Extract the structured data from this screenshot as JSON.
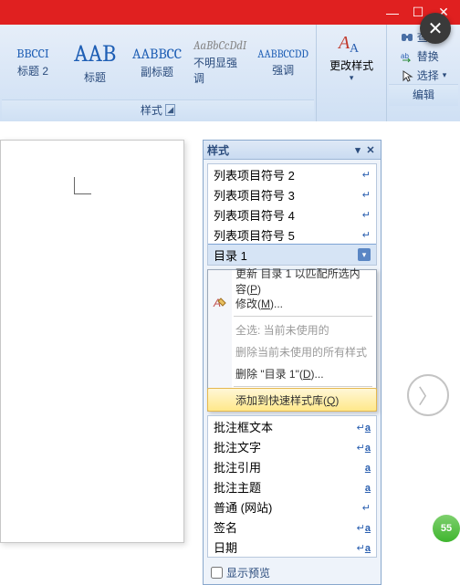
{
  "window": {
    "min": "—",
    "max": "☐",
    "close": "✕"
  },
  "ribbon": {
    "styles": [
      {
        "sample": "BBCCI",
        "label": "标题 2",
        "size": "14px",
        "color": "#1f5fb5"
      },
      {
        "sample": "AAB",
        "label": "标题",
        "size": "26px",
        "color": "#1f5fb5"
      },
      {
        "sample": "AABBCC",
        "label": "副标题",
        "size": "16px",
        "color": "#1f5fb5"
      },
      {
        "sample": "AaBbCcDdI",
        "label": "不明显强调",
        "size": "13px",
        "italic": true,
        "color": "#888"
      },
      {
        "sample": "AABBCCDD",
        "label": "强调",
        "size": "12px",
        "color": "#1f5fb5"
      }
    ],
    "styles_group": "样式",
    "change_styles": "更改样式",
    "edit": {
      "find": "查找",
      "replace": "替换",
      "select": "选择",
      "group": "编辑"
    }
  },
  "pane": {
    "title": "样式",
    "top": [
      {
        "t": "列表项目符号 2",
        "s": "↵"
      },
      {
        "t": "列表项目符号 3",
        "s": "↵"
      },
      {
        "t": "列表项目符号 4",
        "s": "↵"
      },
      {
        "t": "列表项目符号 5",
        "s": "↵"
      },
      {
        "t": "目录 1",
        "sel": true
      }
    ],
    "menu": [
      {
        "t": "更新 目录 1 以匹配所选内容(P)",
        "u": "P"
      },
      {
        "t": "修改(M)...",
        "u": "M",
        "icon": "modify"
      },
      {
        "sep": true
      },
      {
        "t": "全选: 当前未使用的",
        "dis": true
      },
      {
        "t": "删除当前未使用的所有样式",
        "dis": true
      },
      {
        "t": "删除 \"目录 1\"(D)...",
        "u": "D"
      },
      {
        "sep": true
      },
      {
        "t": "添加到快速样式库(Q)",
        "u": "Q",
        "hov": true
      }
    ],
    "bottom": [
      {
        "t": "批注框文本",
        "s": "↵a"
      },
      {
        "t": "批注文字",
        "s": "↵a"
      },
      {
        "t": "批注引用",
        "s": "a"
      },
      {
        "t": "批注主题",
        "s": "a"
      },
      {
        "t": "普通 (网站)",
        "s": "↵"
      },
      {
        "t": "签名",
        "s": "↵a"
      },
      {
        "t": "日期",
        "s": "↵a"
      }
    ],
    "preview": "显示预览"
  },
  "green": "55"
}
